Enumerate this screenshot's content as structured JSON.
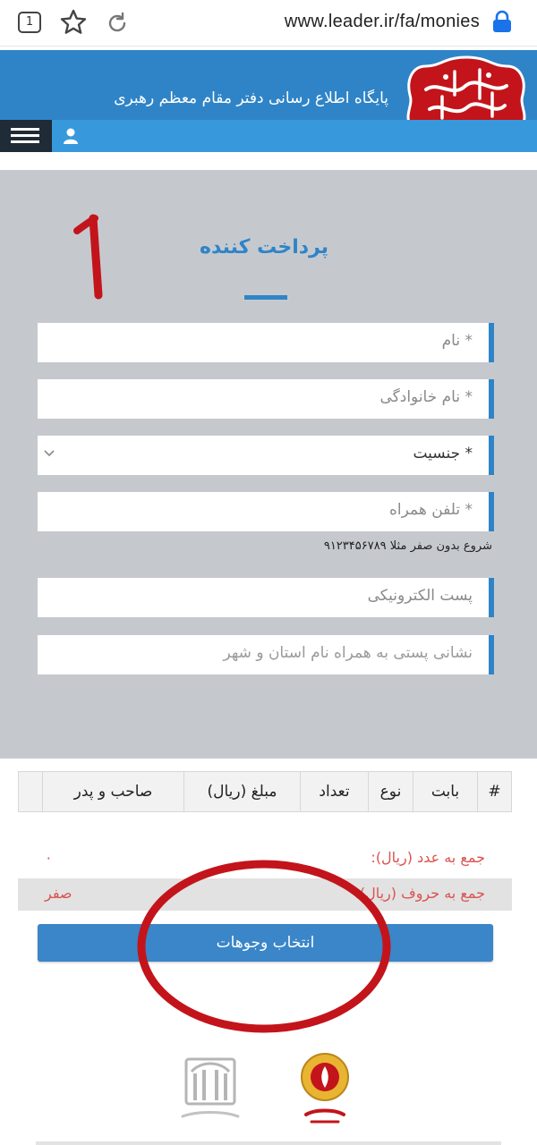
{
  "browser": {
    "tab_count": "1",
    "url": "www.leader.ir/fa/monies"
  },
  "header": {
    "site_title": "پایگاه اطلاع رسانی دفتر مقام معظم رهبری"
  },
  "form": {
    "title": "پرداخت کننده",
    "annotation_number": "۱",
    "fields": {
      "first_name_placeholder": "* نام",
      "last_name_placeholder": "* نام خانوادگی",
      "gender_selected": "* جنسیت",
      "mobile_placeholder": "* تلفن همراه",
      "mobile_hint": "شروع بدون صفر مثلا ۹۱۲۳۴۵۶۷۸۹",
      "email_placeholder": "پست الکترونیکی",
      "address_placeholder": "نشانی پستی به همراه نام استان و شهر"
    }
  },
  "table": {
    "headers": [
      "#",
      "بابت",
      "نوع",
      "تعداد",
      "مبلغ (ریال)",
      "صاحب و پدر",
      ""
    ]
  },
  "totals": {
    "numeric_label": "جمع به عدد (ریال):",
    "numeric_value": "۰",
    "words_label": "جمع به حروف (ریال):",
    "words_value": "صفر"
  },
  "actions": {
    "select_funds_label": "انتخاب وجوهات"
  },
  "colors": {
    "header_blue": "#2f84c7",
    "navbar_blue": "#3898dc",
    "annotation_red": "#c3141b",
    "total_red": "#d9534f"
  }
}
